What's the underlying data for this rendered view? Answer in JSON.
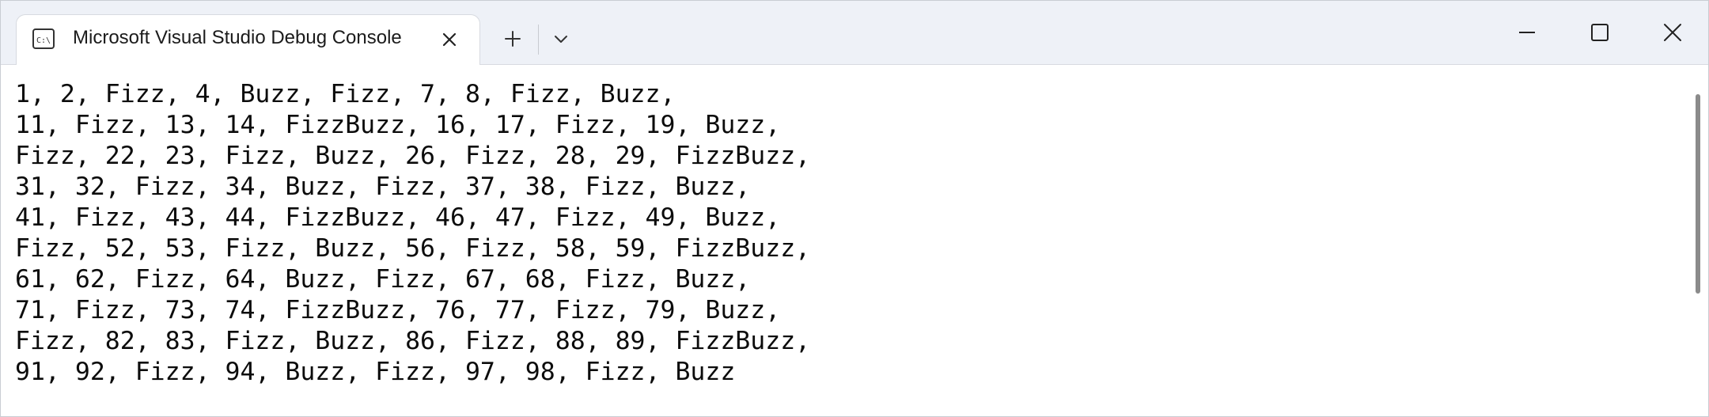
{
  "window": {
    "tab_title": "Microsoft Visual Studio Debug Console",
    "tab_icon": "console-icon",
    "controls": [
      "close-icon",
      "plus-icon",
      "chevron-down-icon",
      "minimize-icon",
      "maximize-icon",
      "window-close-icon"
    ]
  },
  "console": {
    "lines": [
      "1, 2, Fizz, 4, Buzz, Fizz, 7, 8, Fizz, Buzz,",
      "11, Fizz, 13, 14, FizzBuzz, 16, 17, Fizz, 19, Buzz,",
      "Fizz, 22, 23, Fizz, Buzz, 26, Fizz, 28, 29, FizzBuzz,",
      "31, 32, Fizz, 34, Buzz, Fizz, 37, 38, Fizz, Buzz,",
      "41, Fizz, 43, 44, FizzBuzz, 46, 47, Fizz, 49, Buzz,",
      "Fizz, 52, 53, Fizz, Buzz, 56, Fizz, 58, 59, FizzBuzz,",
      "61, 62, Fizz, 64, Buzz, Fizz, 67, 68, Fizz, Buzz,",
      "71, Fizz, 73, 74, FizzBuzz, 76, 77, Fizz, 79, Buzz,",
      "Fizz, 82, 83, Fizz, Buzz, 86, Fizz, 88, 89, FizzBuzz,",
      "91, 92, Fizz, 94, Buzz, Fizz, 97, 98, Fizz, Buzz"
    ]
  },
  "colors": {
    "titlebar_bg": "#eef1f7",
    "tab_bg": "#ffffff",
    "console_bg": "#ffffff",
    "console_text": "#0c0c0c"
  }
}
